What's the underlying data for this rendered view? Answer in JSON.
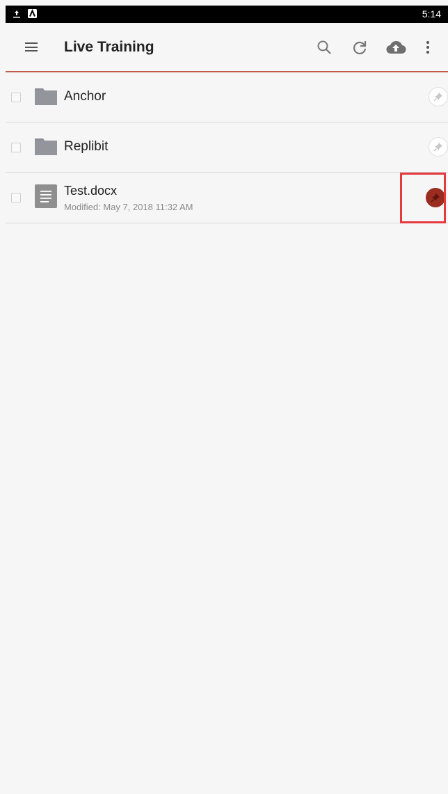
{
  "statusbar": {
    "time": "5:14",
    "icons": [
      "upload-icon",
      "app-a-icon"
    ]
  },
  "appbar": {
    "title": "Live Training",
    "actions": [
      "search-icon",
      "sync-icon",
      "cloud-upload-icon",
      "more-vert-icon"
    ]
  },
  "items": [
    {
      "name": "Anchor",
      "type": "folder",
      "pinned": false
    },
    {
      "name": "Replibit",
      "type": "folder",
      "pinned": false
    },
    {
      "name": "Test.docx",
      "type": "document",
      "modified": "Modified: May 7, 2018 11:32 AM",
      "pinned": true
    }
  ],
  "colors": {
    "accent": "#c55a4a",
    "pin_active": "#9b2c20",
    "highlight": "#e5393d",
    "folder": "#8c8e97"
  }
}
